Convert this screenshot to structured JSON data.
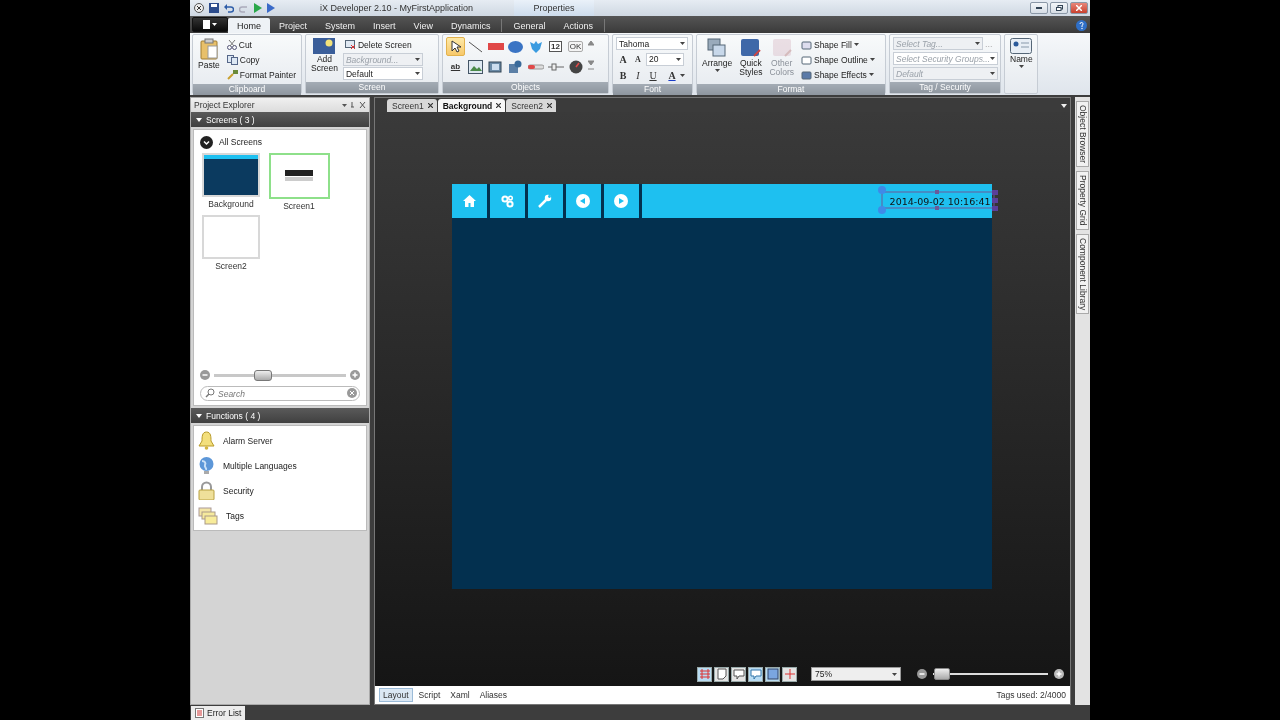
{
  "title_bar": {
    "title": "iX Developer 2.10 - MyFirstApplication",
    "context_tab": "Properties"
  },
  "ribbon_tabs": [
    {
      "label": "Home",
      "selected": true
    },
    {
      "label": "Project",
      "selected": false
    },
    {
      "label": "System",
      "selected": false
    },
    {
      "label": "Insert",
      "selected": false
    },
    {
      "label": "View",
      "selected": false
    },
    {
      "label": "Dynamics",
      "selected": false
    },
    {
      "label": "General",
      "selected": false
    },
    {
      "label": "Actions",
      "selected": false
    }
  ],
  "clipboard": {
    "label": "Clipboard",
    "paste": "Paste",
    "actions": [
      "Cut",
      "Copy",
      "Format Painter"
    ]
  },
  "screen_group": {
    "label": "Screen",
    "add": "Add Screen",
    "delete": "Delete Screen",
    "template_placeholder": "Background...",
    "style": "Default"
  },
  "objects": {
    "label": "Objects",
    "tools": [
      {
        "kind": "pointer",
        "selected": true
      },
      {
        "kind": "line",
        "selected": false
      },
      {
        "kind": "rectangle",
        "selected": false
      },
      {
        "kind": "ellipse",
        "selected": false
      },
      {
        "kind": "polygon",
        "selected": false
      },
      {
        "kind": "numeric",
        "text": "12",
        "selected": false
      },
      {
        "kind": "button",
        "text": "OK",
        "selected": false
      },
      {
        "kind": "text",
        "text": "ab",
        "selected": false
      },
      {
        "kind": "picture",
        "selected": false
      },
      {
        "kind": "media",
        "selected": false
      },
      {
        "kind": "video",
        "selected": false
      },
      {
        "kind": "slider",
        "selected": false
      },
      {
        "kind": "switch",
        "selected": false
      },
      {
        "kind": "gauge",
        "selected": false
      }
    ]
  },
  "font": {
    "label": "Font",
    "family": "Tahoma",
    "size": "20",
    "size_buttons": [
      "A",
      "A"
    ],
    "styles": [
      "B",
      "I",
      "U"
    ],
    "color_button": "A"
  },
  "format": {
    "label": "Format",
    "arrange": "Arrange",
    "quick_styles": "Quick Styles",
    "other_colors": {
      "label": "Other Colors",
      "disabled": true
    },
    "shape_items": [
      "Shape Fill",
      "Shape Outline",
      "Shape Effects"
    ]
  },
  "tag_security": {
    "label": "Tag / Security",
    "tag_placeholder": "Select Tag...",
    "browse": "...",
    "groups_placeholder": "Select Security Groups...",
    "default": "Default"
  },
  "name_button": "Name",
  "project_explorer": {
    "title": "Project Explorer",
    "screens_header": "Screens ( 3 )",
    "all_screens": "All Screens",
    "screens": [
      {
        "name": "Background",
        "kind": "dark",
        "selected": false
      },
      {
        "name": "Screen1",
        "kind": "header",
        "selected": true
      },
      {
        "name": "Screen2",
        "kind": "blank",
        "selected": false
      }
    ],
    "zoom": {
      "level": 0.37
    },
    "search_placeholder": "Search",
    "functions_header": "Functions ( 4 )",
    "functions": [
      {
        "name": "Alarm Server",
        "kind": "bell"
      },
      {
        "name": "Multiple Languages",
        "kind": "globe"
      },
      {
        "name": "Security",
        "kind": "lock"
      },
      {
        "name": "Tags",
        "kind": "folders"
      }
    ]
  },
  "document_tabs": [
    {
      "label": "Screen1",
      "selected": false
    },
    {
      "label": "Background",
      "selected": true
    },
    {
      "label": "Screen2",
      "selected": false
    }
  ],
  "design_screen": {
    "nav_buttons": [
      {
        "kind": "home"
      },
      {
        "kind": "gears"
      },
      {
        "kind": "wrench"
      },
      {
        "kind": "back"
      },
      {
        "kind": "forward"
      }
    ],
    "clock": "2014-09-02 10:16:41"
  },
  "canvas_toolbar": {
    "tools": [
      {
        "kind": "grid",
        "on": true
      },
      {
        "kind": "note",
        "on": false
      },
      {
        "kind": "comment",
        "on": false
      },
      {
        "kind": "callout",
        "on": true
      },
      {
        "kind": "frame",
        "on": true
      },
      {
        "kind": "snap",
        "on": false
      }
    ],
    "zoom": "75%",
    "zoom_slider": {
      "level": 0.08
    }
  },
  "view_tabs": [
    {
      "label": "Layout",
      "selected": true
    },
    {
      "label": "Script",
      "selected": false
    },
    {
      "label": "Xaml",
      "selected": false
    },
    {
      "label": "Aliases",
      "selected": false
    }
  ],
  "tags_used": "Tags used: 2/4000",
  "side_tabs": [
    "Object Browser",
    "Property Grid",
    "Component Library"
  ],
  "bottom_tabs": [
    "Error List"
  ]
}
